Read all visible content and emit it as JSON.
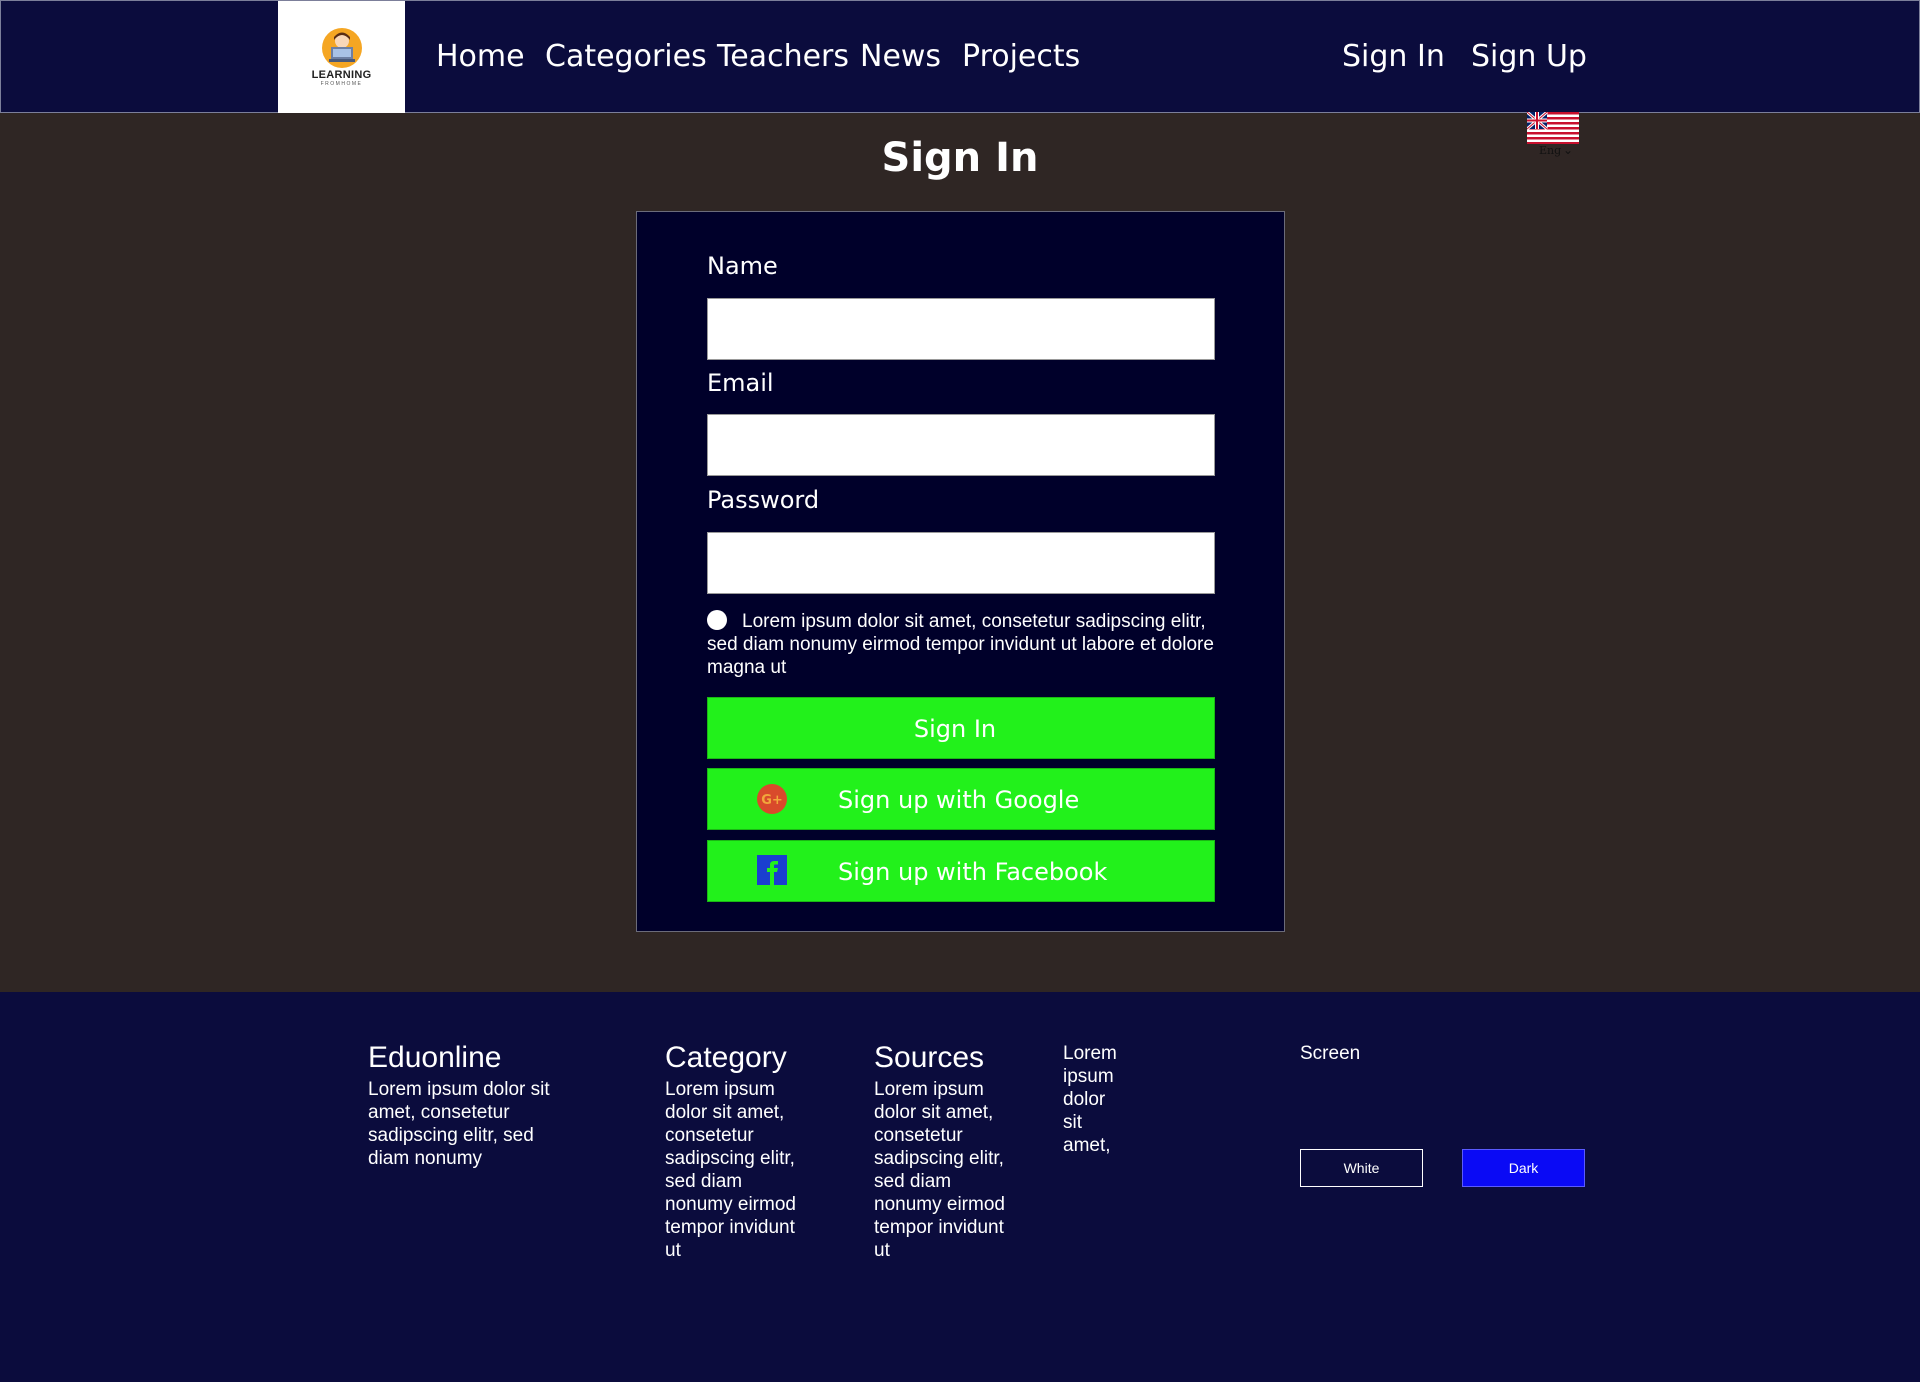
{
  "header": {
    "logo": {
      "text": "LEARNING",
      "sub": "FROMHOME"
    },
    "nav": [
      {
        "label": "Home"
      },
      {
        "label": "Categories"
      },
      {
        "label": "Teachers"
      },
      {
        "label": "News"
      },
      {
        "label": "Projects"
      }
    ],
    "auth": {
      "sign_in": "Sign In",
      "sign_up": "Sign Up"
    },
    "language": {
      "label": "Eng",
      "icon": "us-flag-icon"
    }
  },
  "page": {
    "title": "Sign In"
  },
  "form": {
    "name_label": "Name",
    "name_value": "",
    "email_label": "Email",
    "email_value": "",
    "password_label": "Password",
    "password_value": "",
    "agree_text": "Lorem ipsum dolor sit amet, consetetur sadipscing elitr, sed diam nonumy eirmod tempor invidunt ut labore et dolore magna ut",
    "submit_label": "Sign In",
    "google_label": "Sign up with Google",
    "facebook_label": "Sign up with Facebook"
  },
  "footer": {
    "brand": {
      "heading": "Eduonline",
      "text": "Lorem ipsum dolor sit amet, consetetur sadipscing elitr, sed diam nonumy"
    },
    "category": {
      "heading": "Category",
      "text": "Lorem ipsum dolor sit amet, consetetur sadipscing elitr, sed diam nonumy eirmod tempor invidunt ut"
    },
    "sources": {
      "heading": "Sources",
      "text": "Lorem ipsum dolor sit amet, consetetur sadipscing elitr, sed diam nonumy eirmod tempor invidunt ut"
    },
    "extra": {
      "text": "Lorem ipsum dolor sit amet,"
    },
    "screen": {
      "label": "Screen",
      "white": "White",
      "dark": "Dark"
    }
  },
  "colors": {
    "header_bg": "#0b0c3d",
    "body_bg": "#2f2624",
    "card_bg": "#00002a",
    "button_green": "#22f11b",
    "dark_button": "#0a0af5"
  }
}
